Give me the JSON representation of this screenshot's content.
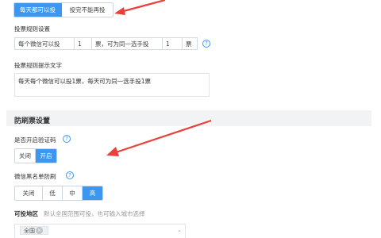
{
  "top_toggle": {
    "options": [
      "每天都可以投",
      "投完不能再投"
    ],
    "selected": 0
  },
  "vote_rule": {
    "title": "投票规则设置",
    "cells": [
      "每个微信可以投",
      "1",
      "票，可为同一选手投",
      "1",
      "票"
    ]
  },
  "vote_hint": {
    "title": "投票规则提示文字",
    "text": "每天每个微信可以投1票，每天可为同一选手投1票"
  },
  "anti_fraud": {
    "section_title": "防刷票设置"
  },
  "captcha": {
    "label": "是否开启验证码",
    "options": [
      "关闭",
      "开启"
    ],
    "selected": 1
  },
  "blacklist": {
    "label": "微信黑名单防刷",
    "options": [
      "关闭",
      "低",
      "中",
      "高"
    ],
    "selected": 3
  },
  "region": {
    "label": "可投地区",
    "hint": "默认全国范围可投，也可输入城市选择",
    "tag": "全国",
    "tag_close": "×"
  },
  "icons": {
    "help": "question-circle-icon",
    "caret": "chevron-down-icon"
  },
  "colors": {
    "accent": "#3d97f0",
    "arrow": "#e8413a"
  }
}
